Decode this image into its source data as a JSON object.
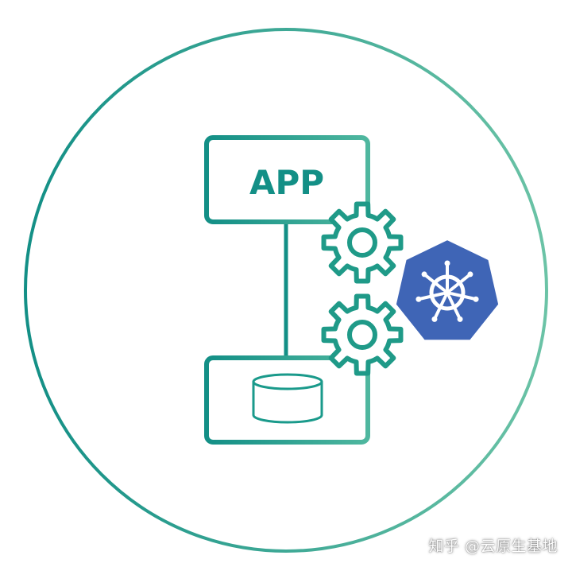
{
  "diagram": {
    "app_label": "APP",
    "icons": {
      "top_gear": "gear-icon",
      "bottom_gear": "gear-icon",
      "kubernetes": "kubernetes-helm-icon",
      "database": "database-icon"
    }
  },
  "colors": {
    "teal_dark": "#138f86",
    "teal_light": "#6bc3a6",
    "kubernetes_blue": "#3f65b6",
    "background": "#ffffff"
  },
  "watermark": {
    "text": "知乎 @云原生基地"
  }
}
